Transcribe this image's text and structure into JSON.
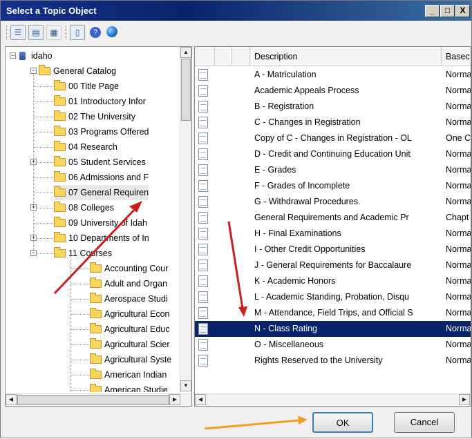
{
  "window": {
    "title": "Select a Topic Object",
    "min_label": "_",
    "max_label": "□",
    "close_label": "X"
  },
  "toolbar": {
    "buttons": [
      "list-view",
      "details-view",
      "properties",
      "new-page",
      "help",
      "web"
    ]
  },
  "tree": {
    "root": "idaho",
    "catalog": "General Catalog",
    "items": [
      "00 Title Page",
      "01 Introductory Infor",
      "02 The University",
      "03 Programs Offered",
      "04 Research",
      "05 Student Services",
      "06 Admissions and F",
      "07 General Requiren",
      "08 Colleges",
      "09 University of Idah",
      "10 Departments of In",
      "11 Courses"
    ],
    "courses": [
      "Accounting Cour",
      "Adult and Organ",
      "Aerospace Studi",
      "Agricultural Econ",
      "Agricultural Educ",
      "Agricultural Scier",
      "Agricultural Syste",
      "American Indian",
      "American Studie"
    ]
  },
  "grid": {
    "columns": {
      "description": "Description",
      "based": "Basec"
    },
    "rows": [
      {
        "desc": "A - Matriculation",
        "based": "Norma"
      },
      {
        "desc": "Academic Appeals Process",
        "based": "Norma"
      },
      {
        "desc": "B - Registration",
        "based": "Norma"
      },
      {
        "desc": "C - Changes in Registration",
        "based": "Norma"
      },
      {
        "desc": "Copy of C - Changes in Registration - OL",
        "based": "One C"
      },
      {
        "desc": "D - Credit and Continuing Education Unit",
        "based": "Norma"
      },
      {
        "desc": "E - Grades",
        "based": "Norma"
      },
      {
        "desc": "F - Grades of Incomplete",
        "based": "Norma"
      },
      {
        "desc": "G - Withdrawal Procedures.",
        "based": "Norma"
      },
      {
        "desc": "General Requirements and Academic Pr",
        "based": "Chapt"
      },
      {
        "desc": "H - Final Examinations",
        "based": "Norma"
      },
      {
        "desc": "I - Other Credit Opportunities",
        "based": "Norma"
      },
      {
        "desc": "J - General Requirements for Baccalaure",
        "based": "Norma"
      },
      {
        "desc": "K - Academic Honors",
        "based": "Norma"
      },
      {
        "desc": "L - Academic Standing, Probation, Disqu",
        "based": "Norma"
      },
      {
        "desc": "M - Attendance, Field Trips, and Official S",
        "based": "Norma"
      },
      {
        "desc": "N - Class Rating",
        "based": "Norma"
      },
      {
        "desc": "O - Miscellaneous",
        "based": "Norma"
      },
      {
        "desc": "Rights Reserved to the University",
        "based": "Norma"
      }
    ]
  },
  "buttons": {
    "ok": "OK",
    "cancel": "Cancel"
  },
  "colors": {
    "selection": "#0a246a",
    "arrow_red": "#c8201e",
    "arrow_orange": "#f0a020"
  }
}
